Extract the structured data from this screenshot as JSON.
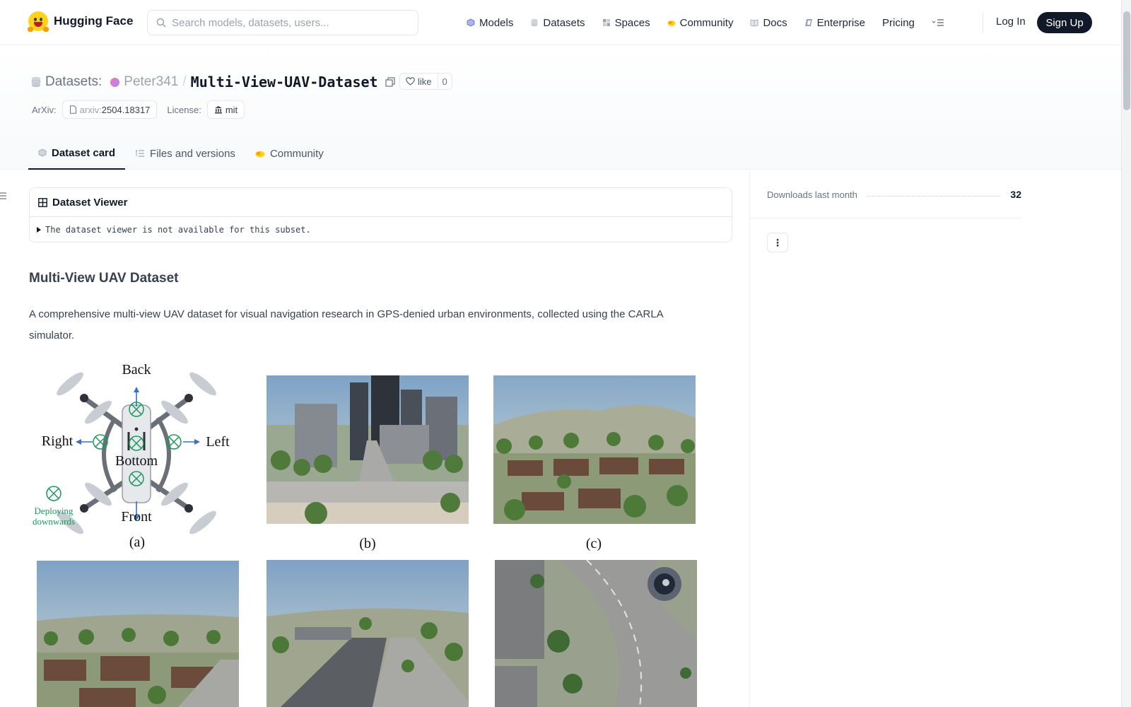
{
  "nav": {
    "brand": "Hugging Face",
    "search_placeholder": "Search models, datasets, users...",
    "links": [
      "Models",
      "Datasets",
      "Spaces",
      "Community",
      "Docs",
      "Enterprise",
      "Pricing"
    ],
    "login": "Log In",
    "signup": "Sign Up"
  },
  "header": {
    "section": "Datasets:",
    "owner": "Peter341",
    "separator": "/",
    "repo": "Multi-View-UAV-Dataset",
    "like_label": "like",
    "like_count": "0",
    "arxiv_label": "ArXiv:",
    "arxiv_prefix": "arxiv:",
    "arxiv_id": "2504.18317",
    "license_label": "License:",
    "license_value": "mit"
  },
  "tabs": [
    "Dataset card",
    "Files and versions",
    "Community"
  ],
  "viewer": {
    "title": "Dataset Viewer",
    "message": "The dataset viewer is not available for this subset."
  },
  "card": {
    "title": "Multi-View UAV Dataset",
    "description": "A comprehensive multi-view UAV dataset for visual navigation research in GPS-denied urban environments, collected using the CARLA simulator."
  },
  "figure": {
    "labels": [
      "(a)",
      "(b)",
      "(c)"
    ],
    "diagram": {
      "back": "Back",
      "right": "Right",
      "left": "Left",
      "bottom": "Bottom",
      "front": "Front",
      "deploy_1": "Deploying",
      "deploy_2": "downwards"
    }
  },
  "sidebar": {
    "downloads_label": "Downloads last month",
    "downloads_value": "32",
    "menu_glyph": "⋮"
  },
  "colors": {
    "brand_yellow": "#ffd21e",
    "dark": "#111827",
    "camera_green": "#1a9a5a",
    "arrow_blue": "#3b6fc4"
  }
}
